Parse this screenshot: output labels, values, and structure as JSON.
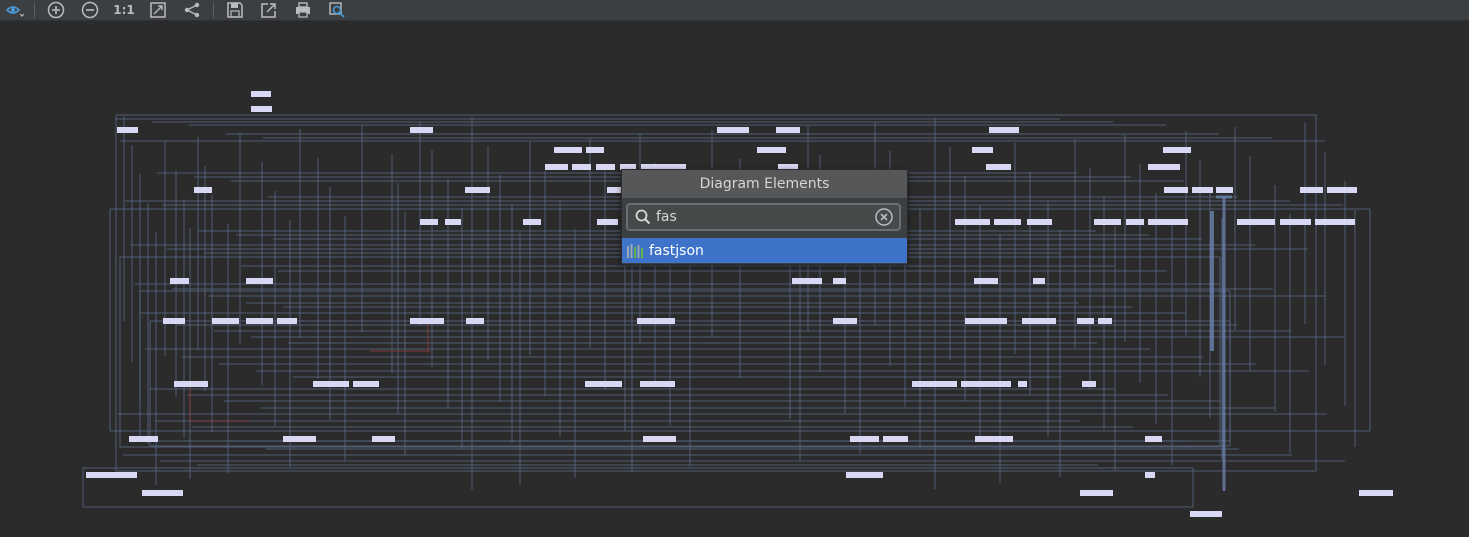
{
  "toolbar": {
    "items": [
      {
        "name": "view-options-icon"
      },
      {
        "name": "zoom-in-icon"
      },
      {
        "name": "zoom-out-icon"
      },
      {
        "name": "actual-size-icon",
        "label": "1:1"
      },
      {
        "name": "fit-content-icon"
      },
      {
        "name": "layout-icon"
      },
      {
        "name": "save-icon"
      },
      {
        "name": "export-icon"
      },
      {
        "name": "print-icon"
      },
      {
        "name": "find-icon"
      }
    ]
  },
  "popup": {
    "title": "Diagram Elements",
    "search_value": "fas",
    "results": [
      {
        "label": "fastjson",
        "icon": "library-icon"
      }
    ]
  },
  "colors": {
    "background": "#2b2b2b",
    "node": "#d8d8f4",
    "edge": "#5b6b8c",
    "selection": "#3e73c9"
  }
}
